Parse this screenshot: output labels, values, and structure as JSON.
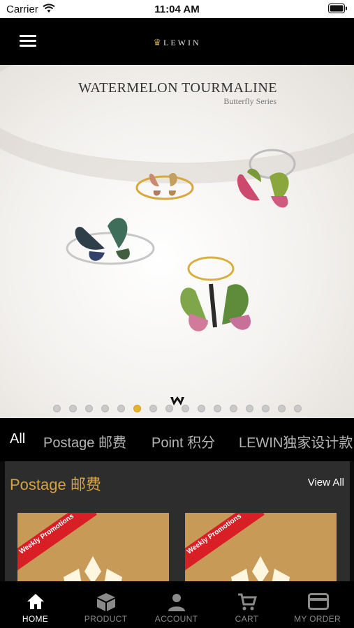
{
  "status_bar": {
    "carrier": "Carrier",
    "time": "11:04 AM"
  },
  "nav": {
    "brand": "LEWIN",
    "menu_icon": "hamburger-menu-icon"
  },
  "banner": {
    "title": "WATERMELON TOURMALINE",
    "subtitle": "Butterfly Series",
    "slide_count": 16,
    "active_slide": 6
  },
  "tabs": [
    {
      "label": "All",
      "active": true
    },
    {
      "label": "Postage 邮费",
      "active": false
    },
    {
      "label": "Point 积分",
      "active": false
    },
    {
      "label": "LEWIN独家设计款",
      "active": false
    }
  ],
  "section": {
    "title": "Postage 邮费",
    "view_all": "View All",
    "cards": [
      {
        "ribbon": "Weekly Promotions"
      },
      {
        "ribbon": "Weekly Promotions"
      }
    ]
  },
  "tab_bar": [
    {
      "label": "HOME",
      "icon": "home-icon",
      "active": true
    },
    {
      "label": "PRODUCT",
      "icon": "box-icon",
      "active": false
    },
    {
      "label": "ACCOUNT",
      "icon": "person-icon",
      "active": false
    },
    {
      "label": "CART",
      "icon": "cart-icon",
      "active": false
    },
    {
      "label": "MY ORDER",
      "icon": "card-icon",
      "active": false
    }
  ],
  "colors": {
    "accent_gold": "#d5a340",
    "ribbon_red": "#d81f26",
    "card_gold": "#c79a57"
  }
}
